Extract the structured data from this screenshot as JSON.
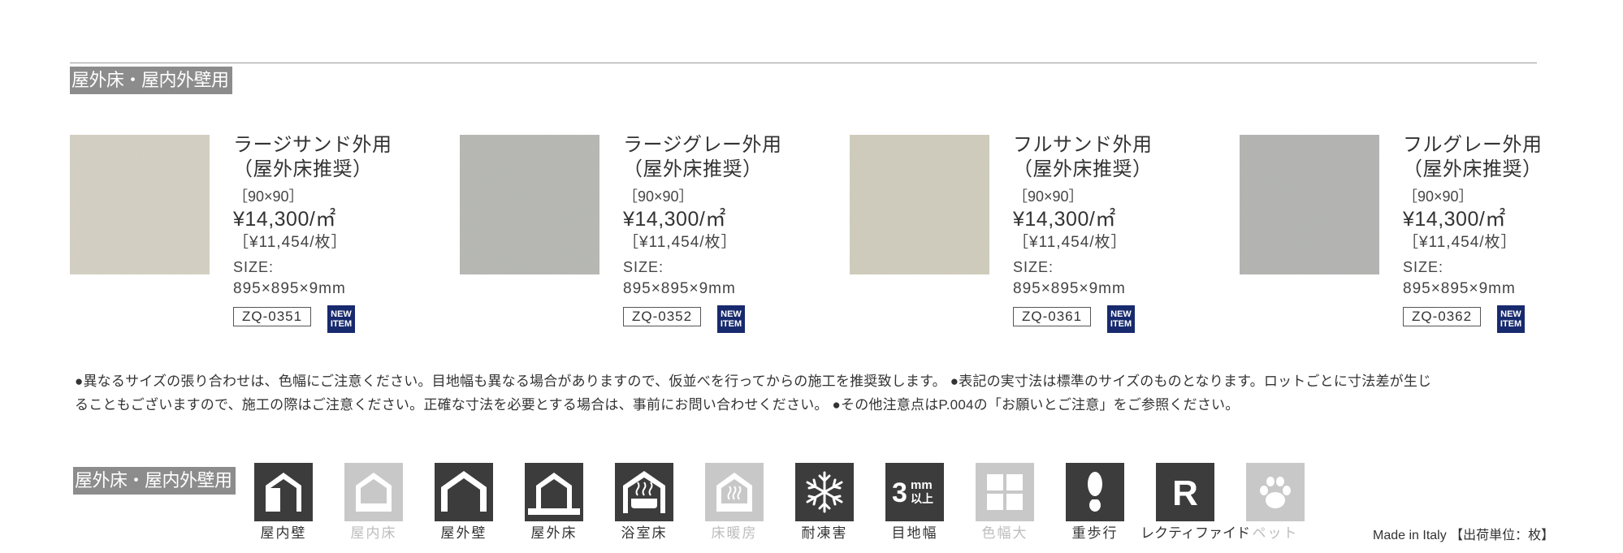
{
  "section_label_top": "屋外床・屋内外壁用",
  "section_label_bottom": "屋外床・屋内外壁用",
  "products": [
    {
      "name_line1": "ラージサンド外用",
      "name_line2": "（屋外床推奨）",
      "size_tag": "［90×90］",
      "price": "¥14,300/㎡",
      "unit_price": "［¥11,454/枚］",
      "size_label": "SIZE:",
      "size_value": "895×895×9mm",
      "code": "ZQ-0351",
      "badge_line1": "NEW",
      "badge_line2": "ITEM",
      "swatch_color": "#d6d3c5"
    },
    {
      "name_line1": "ラージグレー外用",
      "name_line2": "（屋外床推奨）",
      "size_tag": "［90×90］",
      "price": "¥14,300/㎡",
      "unit_price": "［¥11,454/枚］",
      "size_label": "SIZE:",
      "size_value": "895×895×9mm",
      "code": "ZQ-0352",
      "badge_line1": "NEW",
      "badge_line2": "ITEM",
      "swatch_color": "#b9bab5"
    },
    {
      "name_line1": "フルサンド外用",
      "name_line2": "（屋外床推奨）",
      "size_tag": "［90×90］",
      "price": "¥14,300/㎡",
      "unit_price": "［¥11,454/枚］",
      "size_label": "SIZE:",
      "size_value": "895×895×9mm",
      "code": "ZQ-0361",
      "badge_line1": "NEW",
      "badge_line2": "ITEM",
      "swatch_color": "#d2cfbf"
    },
    {
      "name_line1": "フルグレー外用",
      "name_line2": "（屋外床推奨）",
      "size_tag": "［90×90］",
      "price": "¥14,300/㎡",
      "unit_price": "［¥11,454/枚］",
      "size_label": "SIZE:",
      "size_value": "895×895×9mm",
      "code": "ZQ-0362",
      "badge_line1": "NEW",
      "badge_line2": "ITEM",
      "swatch_color": "#b6b7b4"
    }
  ],
  "notes_line1": "●異なるサイズの張り合わせは、色幅にご注意ください。目地幅も異なる場合がありますので、仮並べを行ってからの施工を推奨致します。 ●表記の実寸法は標準のサイズのものとなります。ロットごとに寸法差が生じ",
  "notes_line2": "ることもございますので、施工の際はご注意ください。正確な寸法を必要とする場合は、事前にお問い合わせください。 ●その他注意点はP.004の「お願いとご注意」をご参照ください。",
  "icons": [
    {
      "caption": "屋内壁",
      "icon": "indoor-wall-icon",
      "enabled": true
    },
    {
      "caption": "屋内床",
      "icon": "indoor-floor-icon",
      "enabled": false
    },
    {
      "caption": "屋外壁",
      "icon": "outdoor-wall-icon",
      "enabled": true
    },
    {
      "caption": "屋外床",
      "icon": "outdoor-floor-icon",
      "enabled": true
    },
    {
      "caption": "浴室床",
      "icon": "bathroom-floor-icon",
      "enabled": true
    },
    {
      "caption": "床暖房",
      "icon": "floor-heating-icon",
      "enabled": false
    },
    {
      "caption": "耐凍害",
      "icon": "frost-resistance-icon",
      "enabled": true
    },
    {
      "caption": "目地幅",
      "icon": "joint-width-icon",
      "enabled": true,
      "value": "3",
      "unit_top": "mm",
      "unit_bottom": "以上"
    },
    {
      "caption": "色幅大",
      "icon": "color-variation-icon",
      "enabled": false
    },
    {
      "caption": "重歩行",
      "icon": "heavy-traffic-icon",
      "enabled": true
    },
    {
      "caption": "レクティファイド",
      "icon": "rectified-icon",
      "enabled": true,
      "letter": "R"
    },
    {
      "caption": "ペット",
      "icon": "pet-icon",
      "enabled": false
    }
  ],
  "footer_note": "Made in Italy 【出荷単位：枚】"
}
